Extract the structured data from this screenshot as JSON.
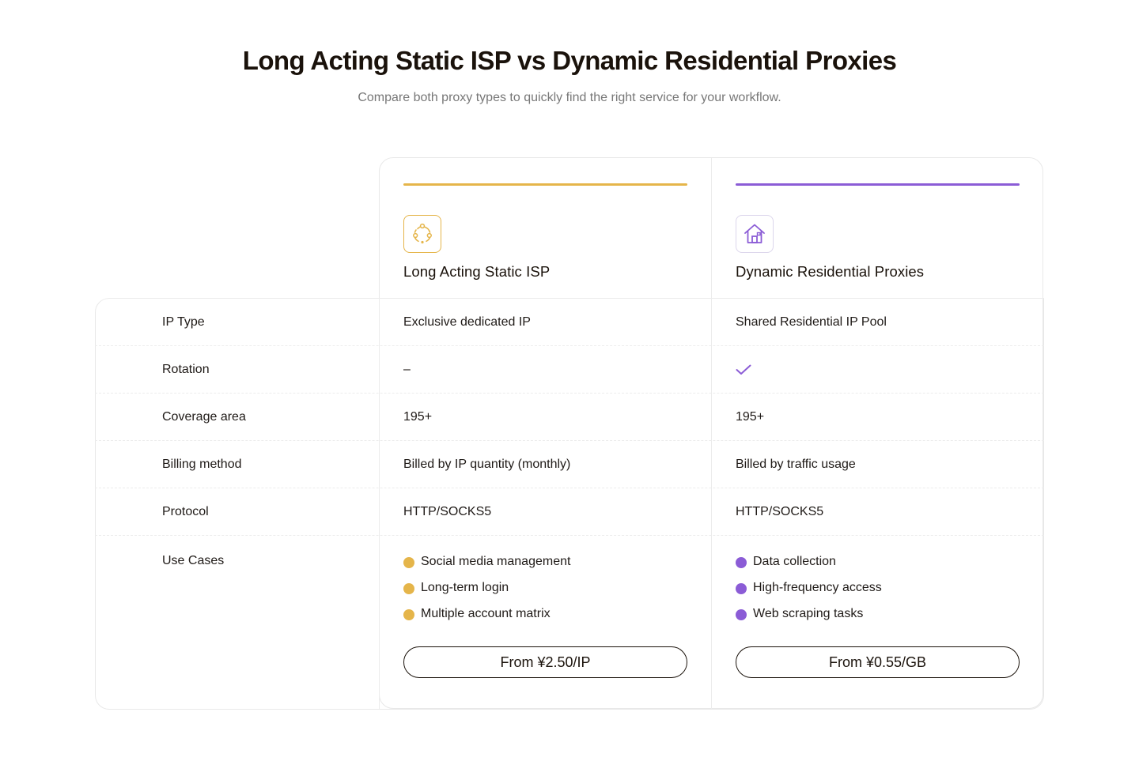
{
  "header": {
    "title": "Long Acting Static ISP vs Dynamic Residential Proxies",
    "subtitle": "Compare both proxy types to quickly find the right service for your workflow."
  },
  "colors": {
    "isp_accent": "#E5B54A",
    "residential_accent": "#8B5CD6",
    "title": "#1A120B",
    "subtitle": "#777777",
    "border": "#ECECEC"
  },
  "products": [
    {
      "name": "Long Acting Static ISP",
      "icon": "rotation-nodes-icon",
      "price_label": "From ¥2.50/IP"
    },
    {
      "name": "Dynamic Residential Proxies",
      "icon": "house-icon",
      "price_label": "From ¥0.55/GB"
    }
  ],
  "rows": [
    {
      "label": "IP Type",
      "isp": "Exclusive dedicated IP",
      "residential": "Shared Residential IP Pool"
    },
    {
      "label": "Rotation",
      "isp": "–",
      "residential": "check-icon"
    },
    {
      "label": "Coverage area",
      "isp": "195+",
      "residential": "195+"
    },
    {
      "label": "Billing method",
      "isp": "Billed by IP quantity (monthly)",
      "residential": "Billed by traffic usage"
    },
    {
      "label": "Protocol",
      "isp": "HTTP/SOCKS5",
      "residential": "HTTP/SOCKS5"
    }
  ],
  "use_cases": {
    "label": "Use Cases",
    "isp": [
      "Social media management",
      "Long-term login",
      "Multiple account matrix"
    ],
    "residential": [
      "Data collection",
      "High-frequency access",
      "Web scraping tasks"
    ]
  }
}
